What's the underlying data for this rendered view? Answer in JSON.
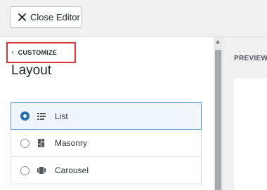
{
  "toolbar": {
    "close_label": "Close Editor",
    "close_icon": "close-icon"
  },
  "sidebar": {
    "back_label": "CUSTOMIZE",
    "back_icon": "chevron-left-icon",
    "title": "Layout",
    "options": [
      {
        "label": "List",
        "icon": "list-layout-icon",
        "selected": true
      },
      {
        "label": "Masonry",
        "icon": "masonry-layout-icon",
        "selected": false
      },
      {
        "label": "Carousel",
        "icon": "carousel-layout-icon",
        "selected": false
      }
    ]
  },
  "preview": {
    "label": "PREVIEW"
  },
  "colors": {
    "accent": "#2271b1",
    "highlight": "#d63638",
    "selected_bg": "#f0f6fc"
  }
}
